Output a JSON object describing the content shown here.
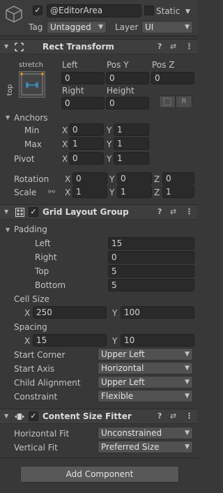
{
  "header": {
    "name": "@EditorArea",
    "active": true,
    "static_label": "Static",
    "static_checked": false,
    "tag_label": "Tag",
    "tag_value": "Untagged",
    "layer_label": "Layer",
    "layer_value": "UI"
  },
  "rect_transform": {
    "title": "Rect Transform",
    "anchor_h": "stretch",
    "anchor_v": "top",
    "col1": "Left",
    "col2": "Pos Y",
    "col3": "Pos Z",
    "left": "0",
    "pos_y": "0",
    "pos_z": "0",
    "right_label": "Right",
    "height_label": "Height",
    "right": "0",
    "height": "0",
    "r_button": "R",
    "anchors_label": "Anchors",
    "min_label": "Min",
    "max_label": "Max",
    "min_x": "0",
    "min_y": "1",
    "max_x": "1",
    "max_y": "1",
    "pivot_label": "Pivot",
    "pivot_x": "0",
    "pivot_y": "1",
    "rotation_label": "Rotation",
    "rot_x": "0",
    "rot_y": "0",
    "rot_z": "0",
    "scale_label": "Scale",
    "scale_x": "1",
    "scale_y": "1",
    "scale_z": "1",
    "x": "X",
    "y": "Y",
    "z": "Z"
  },
  "grid_layout": {
    "title": "Grid Layout Group",
    "enabled": true,
    "padding_label": "Padding",
    "left_label": "Left",
    "right_label": "Right",
    "top_label": "Top",
    "bottom_label": "Bottom",
    "left": "15",
    "right": "0",
    "top": "5",
    "bottom": "5",
    "cell_size_label": "Cell Size",
    "cell_x": "250",
    "cell_y": "100",
    "spacing_label": "Spacing",
    "spacing_x": "15",
    "spacing_y": "10",
    "start_corner_label": "Start Corner",
    "start_corner": "Upper Left",
    "start_axis_label": "Start Axis",
    "start_axis": "Horizontal",
    "child_alignment_label": "Child Alignment",
    "child_alignment": "Upper Left",
    "constraint_label": "Constraint",
    "constraint": "Flexible"
  },
  "content_size_fitter": {
    "title": "Content Size Fitter",
    "enabled": true,
    "horizontal_label": "Horizontal Fit",
    "horizontal": "Unconstrained",
    "vertical_label": "Vertical Fit",
    "vertical": "Preferred Size"
  },
  "add_component": "Add Component",
  "icons": {
    "help": "?",
    "presets": "⇄",
    "menu": "⋮",
    "fold_open": "▼",
    "check": "✓",
    "dropdown_arrow": "▼",
    "link": "⚯"
  }
}
